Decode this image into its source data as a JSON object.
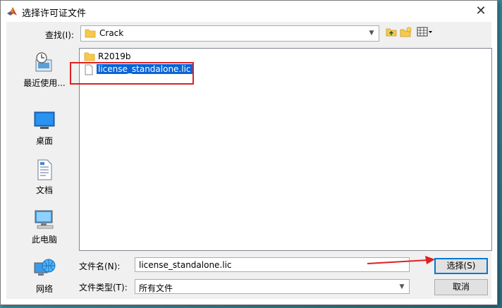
{
  "window": {
    "title": "选择许可证文件"
  },
  "lookin": {
    "label": "查找(I):",
    "value": "Crack"
  },
  "places": [
    {
      "name": "recent",
      "label": "最近使用..."
    },
    {
      "name": "desktop",
      "label": "桌面"
    },
    {
      "name": "documents",
      "label": "文档"
    },
    {
      "name": "this-pc",
      "label": "此电脑"
    },
    {
      "name": "network",
      "label": "网络"
    }
  ],
  "files": [
    {
      "name": "R2019b",
      "kind": "folder"
    },
    {
      "name": "license_standalone.lic",
      "kind": "file",
      "selected": true
    }
  ],
  "filename": {
    "label": "文件名(N):",
    "value": "license_standalone.lic"
  },
  "filetype": {
    "label": "文件类型(T):",
    "value": "所有文件"
  },
  "buttons": {
    "select": "选择(S)",
    "cancel": "取消"
  },
  "colors": {
    "accent": "#0078d7",
    "selection": "#0a63d6",
    "annotation": "#e02020"
  }
}
